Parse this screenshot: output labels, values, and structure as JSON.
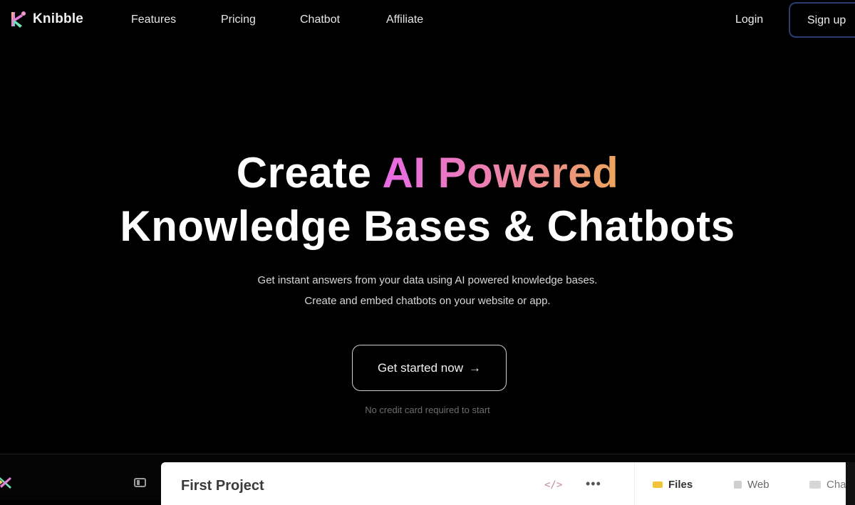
{
  "nav": {
    "brand": "Knibble",
    "links": [
      "Features",
      "Pricing",
      "Chatbot",
      "Affiliate"
    ],
    "login": "Login",
    "signup": "Sign up"
  },
  "hero": {
    "title_prefix": "Create ",
    "title_highlight": "AI Powered",
    "title_line2": "Knowledge Bases & Chatbots",
    "subtitle_line1": "Get instant answers from your data using AI powered knowledge bases.",
    "subtitle_line2": "Create and embed chatbots on your website or app.",
    "cta_label": "Get started now",
    "cta_arrow": "→",
    "note": "No credit card required to start",
    "gradient_colors": [
      "#e86ae6",
      "#ec7fb0",
      "#eca55c"
    ]
  },
  "app_preview": {
    "project_title": "First Project",
    "code_icon": "</>",
    "more_icon": "•••",
    "tabs": [
      "Files",
      "Web",
      "Cha"
    ]
  }
}
